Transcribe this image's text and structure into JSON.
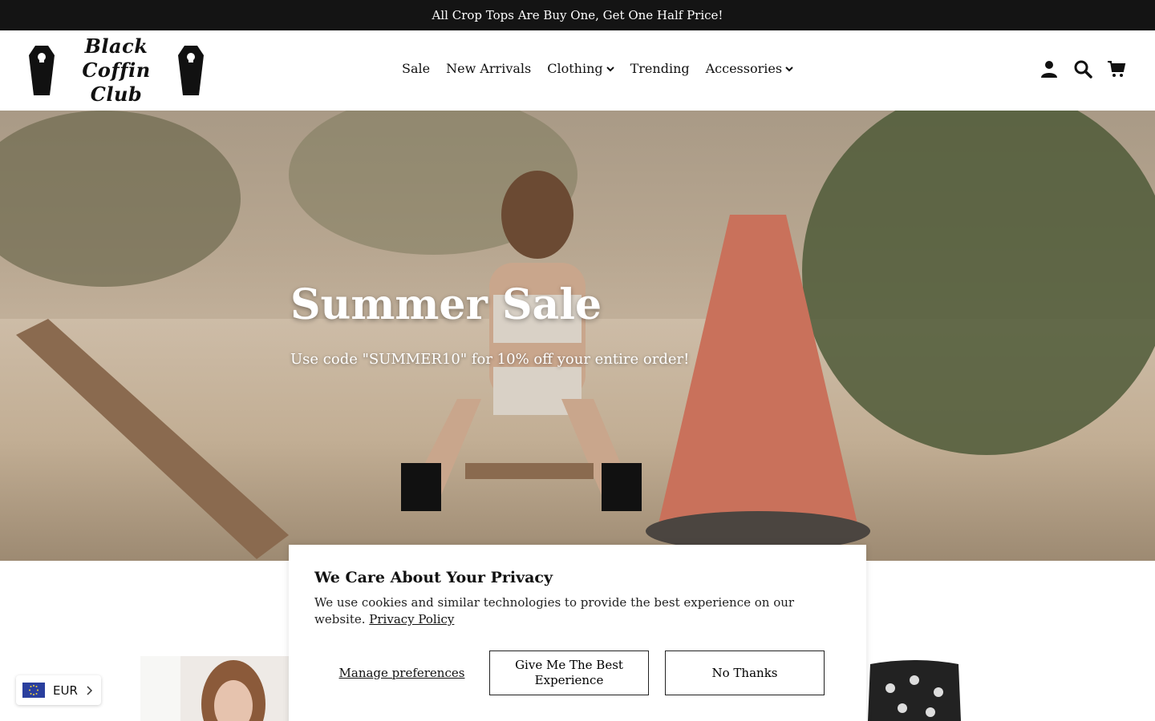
{
  "announcement": {
    "text": "All Crop Tops Are Buy One, Get One Half Price!"
  },
  "logo": {
    "line1": "Black Coffin",
    "line2": "Club"
  },
  "nav": {
    "items": [
      {
        "label": "Sale"
      },
      {
        "label": "New Arrivals"
      },
      {
        "label": "Clothing"
      },
      {
        "label": "Trending"
      },
      {
        "label": "Accessories"
      }
    ]
  },
  "header_icons": [
    "account-icon",
    "search-icon",
    "cart-icon"
  ],
  "hero": {
    "title": "Summer Sale",
    "subtitle": "Use code \"SUMMER10\" for 10% off your entire order!"
  },
  "cookie_banner": {
    "title": "We Care About Your Privacy",
    "body": "We use cookies and similar technologies to provide the best experience on our website.",
    "privacy_link": "Privacy Policy",
    "manage_label": "Manage preferences",
    "accept_label": "Give Me The Best Experience",
    "decline_label": "No Thanks"
  },
  "currency": {
    "code": "EUR"
  },
  "colors": {
    "announcement_bg": "#141414",
    "text": "#111111",
    "hero_text": "#ffffff"
  }
}
